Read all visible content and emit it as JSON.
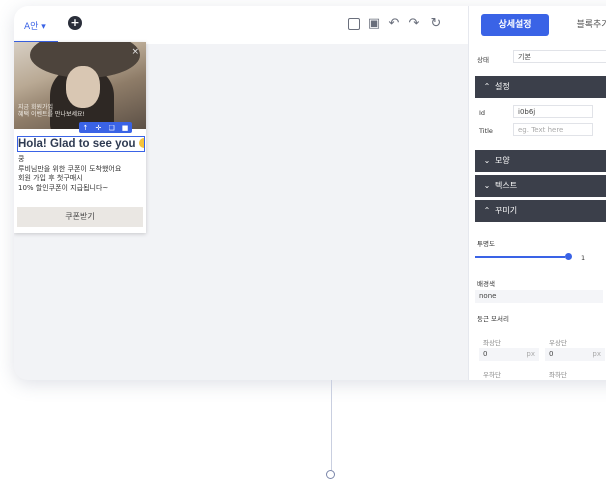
{
  "topbar": {
    "tab_label": "A안 ▾",
    "add_icon": "plus-circle-icon",
    "tools": [
      "square-icon",
      "zoom-icon",
      "undo-icon",
      "redo-icon",
      "refresh-icon"
    ]
  },
  "popup": {
    "photo_caption_line1": "지금 회원가입",
    "photo_caption_line2": "혜택 이벤트를 만나보세요!",
    "close_glyph": "×",
    "headline": "Hola! Glad to see you",
    "body_lines": [
      "쿵",
      "루비님만을 위한 쿠폰이 도착했어요",
      "회원 가입 후 첫구매시",
      "10% 할인쿠폰이 지급됩니다~"
    ],
    "button_label": "쿠폰받기"
  },
  "panel": {
    "tab_detail": "상세설정",
    "tab_add_block": "블록추가",
    "state_label": "상태",
    "state_value": "기본",
    "section_settings": "설정",
    "id_label": "Id",
    "id_value": "i0b6j",
    "title_label": "Title",
    "title_placeholder": "eg. Text here",
    "section_shape": "모양",
    "section_text": "텍스트",
    "section_decor": "꾸미기",
    "opacity_label": "투명도",
    "opacity_value": "1",
    "bg_label": "배경색",
    "bg_value": "none",
    "radius_label": "둥근 모서리",
    "top_left_label": "좌상단",
    "top_right_label": "우상단",
    "top_left_value": "0",
    "top_right_value": "0",
    "unit": "px",
    "bottom_left_label": "우하단",
    "bottom_right_label": "좌하단"
  },
  "colors": {
    "accent": "#3a63e6",
    "section_bg": "#3b3f4a"
  }
}
